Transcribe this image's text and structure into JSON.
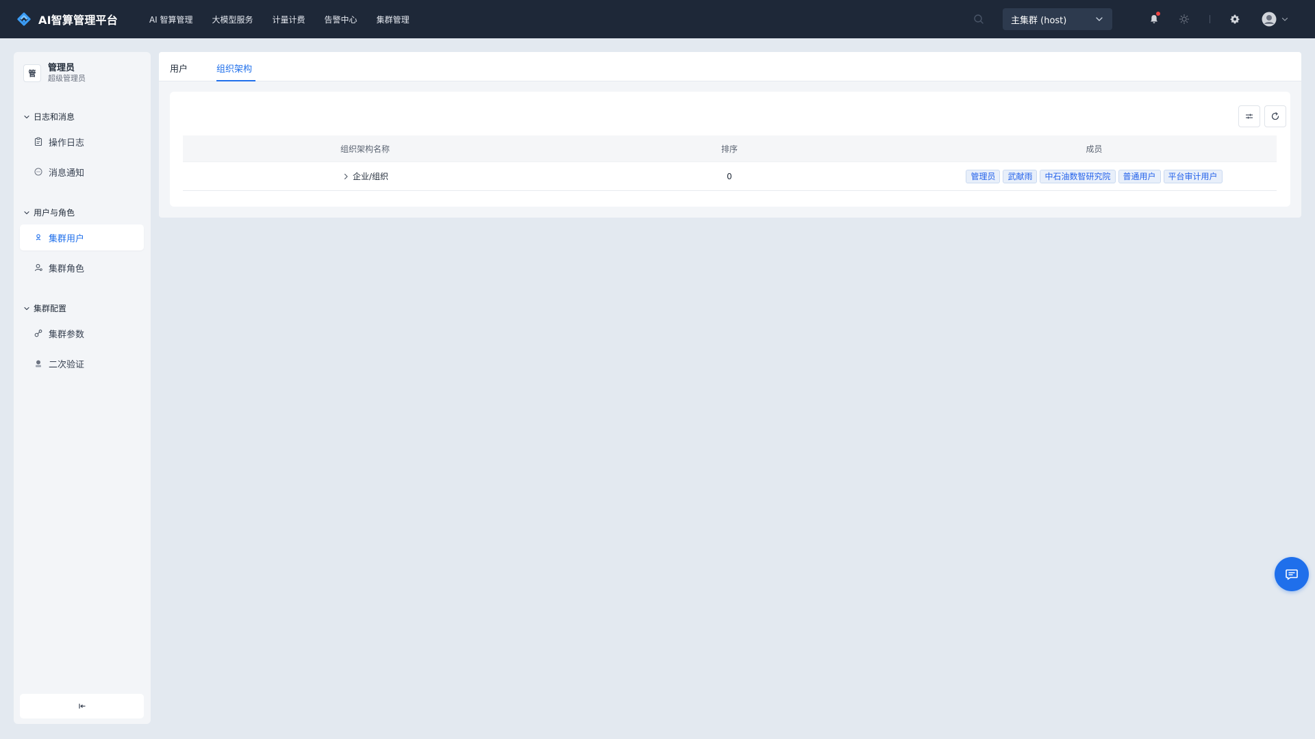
{
  "app": {
    "title": "AI智算管理平台",
    "accent_color": "#1f6feb",
    "logo_icon": "ai-logo-icon"
  },
  "topnav": {
    "items": [
      "AI 智算管理",
      "大模型服务",
      "计量计费",
      "告警中心",
      "集群管理"
    ]
  },
  "header": {
    "cluster_select": "主集群 (host)",
    "notification_badge": true
  },
  "sidebar": {
    "user": {
      "avatar_text": "管",
      "name": "管理员",
      "role": "超级管理员"
    },
    "groups": [
      {
        "title": "日志和消息",
        "items": [
          {
            "label": "操作日志",
            "icon": "clipboard-icon",
            "active": false
          },
          {
            "label": "消息通知",
            "icon": "message-icon",
            "active": false
          }
        ]
      },
      {
        "title": "用户与角色",
        "items": [
          {
            "label": "集群用户",
            "icon": "users-icon",
            "active": true
          },
          {
            "label": "集群角色",
            "icon": "user-role-icon",
            "active": false
          }
        ]
      },
      {
        "title": "集群配置",
        "items": [
          {
            "label": "集群参数",
            "icon": "params-icon",
            "active": false
          },
          {
            "label": "二次验证",
            "icon": "verify-icon",
            "active": false
          }
        ]
      }
    ]
  },
  "tabs": {
    "items": [
      "用户",
      "组织架构"
    ],
    "active": "组织架构"
  },
  "table": {
    "columns": [
      "组织架构名称",
      "排序",
      "成员"
    ],
    "rows": [
      {
        "name": "企业/组织",
        "order": "0",
        "members": [
          "管理员",
          "武献雨",
          "中石油数智研究院",
          "普通用户",
          "平台审计用户"
        ]
      }
    ]
  }
}
